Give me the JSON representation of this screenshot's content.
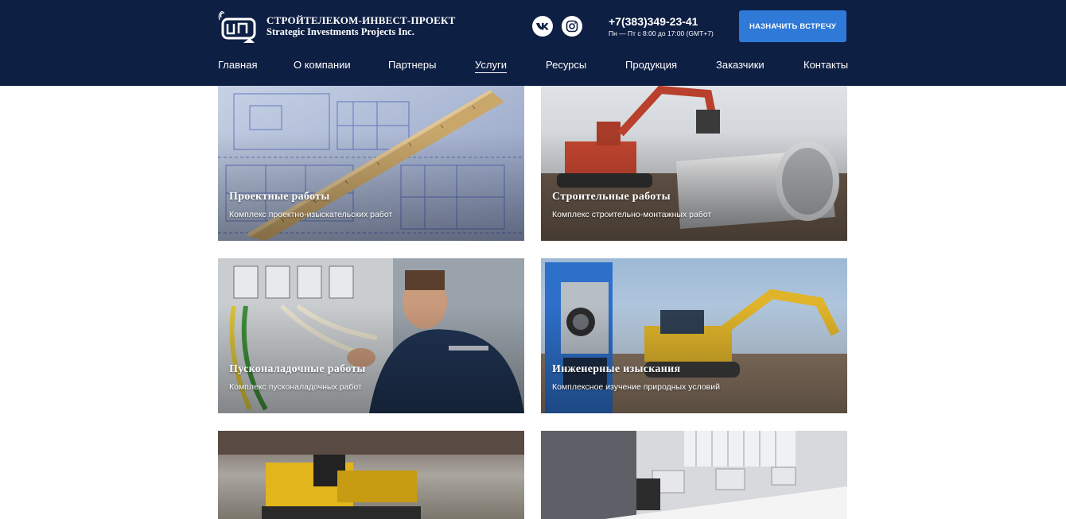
{
  "header": {
    "brand_line1": "СТРОЙТЕЛЕКОМ-ИНВЕСТ-ПРОЕКТ",
    "brand_line2": "Strategic Investments Projects Inc.",
    "logo_text": "СИП",
    "phone": "+7(383)349-23-41",
    "hours": "Пн — Пт с 8:00 до 17:00 (GMT+7)",
    "cta_label": "НАЗНАЧИТЬ ВСТРЕЧУ",
    "social": [
      "vk-icon",
      "instagram-icon"
    ]
  },
  "nav": {
    "items": [
      {
        "label": "Главная"
      },
      {
        "label": "О компании"
      },
      {
        "label": "Партнеры"
      },
      {
        "label": "Услуги"
      },
      {
        "label": "Ресурсы"
      },
      {
        "label": "Продукция"
      },
      {
        "label": "Заказчики"
      },
      {
        "label": "Контакты"
      }
    ],
    "active": "Услуги"
  },
  "services": [
    {
      "title": "Проектные работы",
      "subtitle": "Комплекс проектно-изыскательских работ",
      "image": "blueprint-ruler"
    },
    {
      "title": "Строительные работы",
      "subtitle": "Комплекс строительно-монтажных работ",
      "image": "excavator-pipe"
    },
    {
      "title": "Пусконаладочные работы",
      "subtitle": "Комплекс пусконаладочных работ",
      "image": "engineer-wiring"
    },
    {
      "title": "Инженерные изыскания",
      "subtitle": "Комплексное изучение природных условий",
      "image": "total-station-excavator"
    },
    {
      "title": "",
      "subtitle": "",
      "image": "drilling-rig"
    },
    {
      "title": "",
      "subtitle": "",
      "image": "office-computers"
    }
  ],
  "colors": {
    "header_bg": "#0e1f44",
    "cta_bg": "#2f7ad8",
    "text_light": "#ffffff"
  }
}
